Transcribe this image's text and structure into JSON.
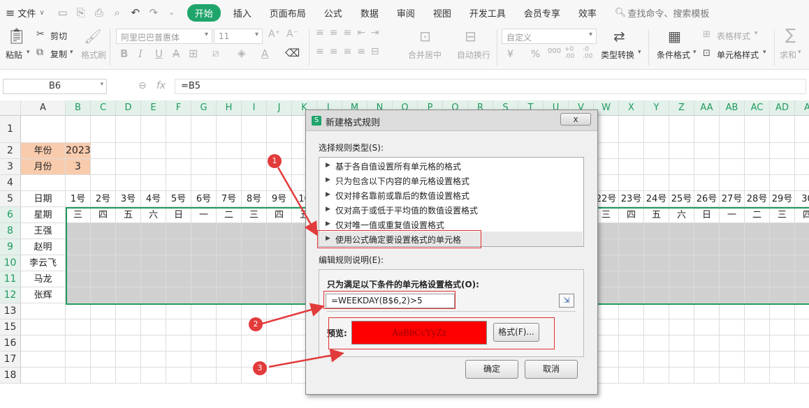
{
  "menu": {
    "file_label": "文件",
    "tabs": [
      "开始",
      "插入",
      "页面布局",
      "公式",
      "数据",
      "审阅",
      "视图",
      "开发工具",
      "会员专享",
      "效率"
    ],
    "search_placeholder": "查找命令、搜索模板"
  },
  "ribbon": {
    "paste": "粘贴",
    "cut": "剪切",
    "copy": "复制",
    "format_painter": "格式刷",
    "font_name": "阿里巴巴普惠体",
    "font_size": "11",
    "merge_center": "合并居中",
    "wrap_text": "自动换行",
    "number_format": "自定义",
    "type_convert": "类型转换",
    "conditional_format": "条件格式",
    "table_style": "表格样式",
    "cell_style": "单元格样式",
    "sum": "求和",
    "bold": "B",
    "italic": "I",
    "underline": "U",
    "font_color_letter": "A",
    "currency": "¥",
    "percent": "%",
    "thousands": "000",
    "decimal_inc": "+0 .00",
    "decimal_dec": "-0 .00"
  },
  "formula_bar": {
    "cell_ref": "B6",
    "fx": "fx",
    "formula": "=B5"
  },
  "sheet": {
    "col_letters": [
      "A",
      "B",
      "C",
      "D",
      "E",
      "F",
      "G",
      "H",
      "I",
      "J",
      "K",
      "L",
      "M",
      "N",
      "O",
      "P",
      "Q",
      "R",
      "S",
      "T",
      "U",
      "V",
      "W",
      "X",
      "Y",
      "Z",
      "AA",
      "AB",
      "AC",
      "AD",
      "A"
    ],
    "row_numbers": [
      "1",
      "2",
      "3",
      "4",
      "5",
      "6",
      "8",
      "9",
      "10",
      "11",
      "12",
      "13",
      "15",
      "16",
      "17",
      "18"
    ],
    "year_label": "年份",
    "year_value": "2023",
    "month_label": "月份",
    "month_value": "3",
    "date_label": "日期",
    "weekday_label": "星期",
    "dates": [
      "1号",
      "2号",
      "3号",
      "4号",
      "5号",
      "6号",
      "7号",
      "8号",
      "9号",
      "10",
      "22号",
      "23号",
      "24号",
      "25号",
      "26号",
      "27号",
      "28号",
      "29号",
      "30"
    ],
    "weekdays": [
      "三",
      "四",
      "五",
      "六",
      "日",
      "一",
      "二",
      "三",
      "四",
      "五",
      "三",
      "四",
      "五",
      "六",
      "日",
      "一",
      "二",
      "三",
      "四"
    ],
    "names": [
      "王强",
      "赵明",
      "李云飞",
      "马龙",
      "张辉"
    ]
  },
  "dialog": {
    "title": "新建格式规则",
    "select_type_label": "选择规则类型(S):",
    "rule_types": [
      "基于各自值设置所有单元格的格式",
      "只为包含以下内容的单元格设置格式",
      "仅对排名靠前或靠后的数值设置格式",
      "仅对高于或低于平均值的数值设置格式",
      "仅对唯一值或重复值设置格式",
      "使用公式确定要设置格式的单元格"
    ],
    "edit_desc_label": "编辑规则说明(E):",
    "condition_label": "只为满足以下条件的单元格设置格式(O):",
    "formula": "=WEEKDAY(B$6,2)>5",
    "preview_label": "预览:",
    "preview_text": "AaBbCcYyZz",
    "format_button": "格式(F)...",
    "ok_button": "确定",
    "cancel_button": "取消",
    "close_glyph": "x",
    "app_icon_letter": "S"
  },
  "annotations": [
    "1",
    "2",
    "3"
  ],
  "colors": {
    "accent_green": "#1fa56b",
    "preview_red": "#ff0000",
    "header_orange": "#f8cbad",
    "annotation_red": "#e23b3b"
  }
}
